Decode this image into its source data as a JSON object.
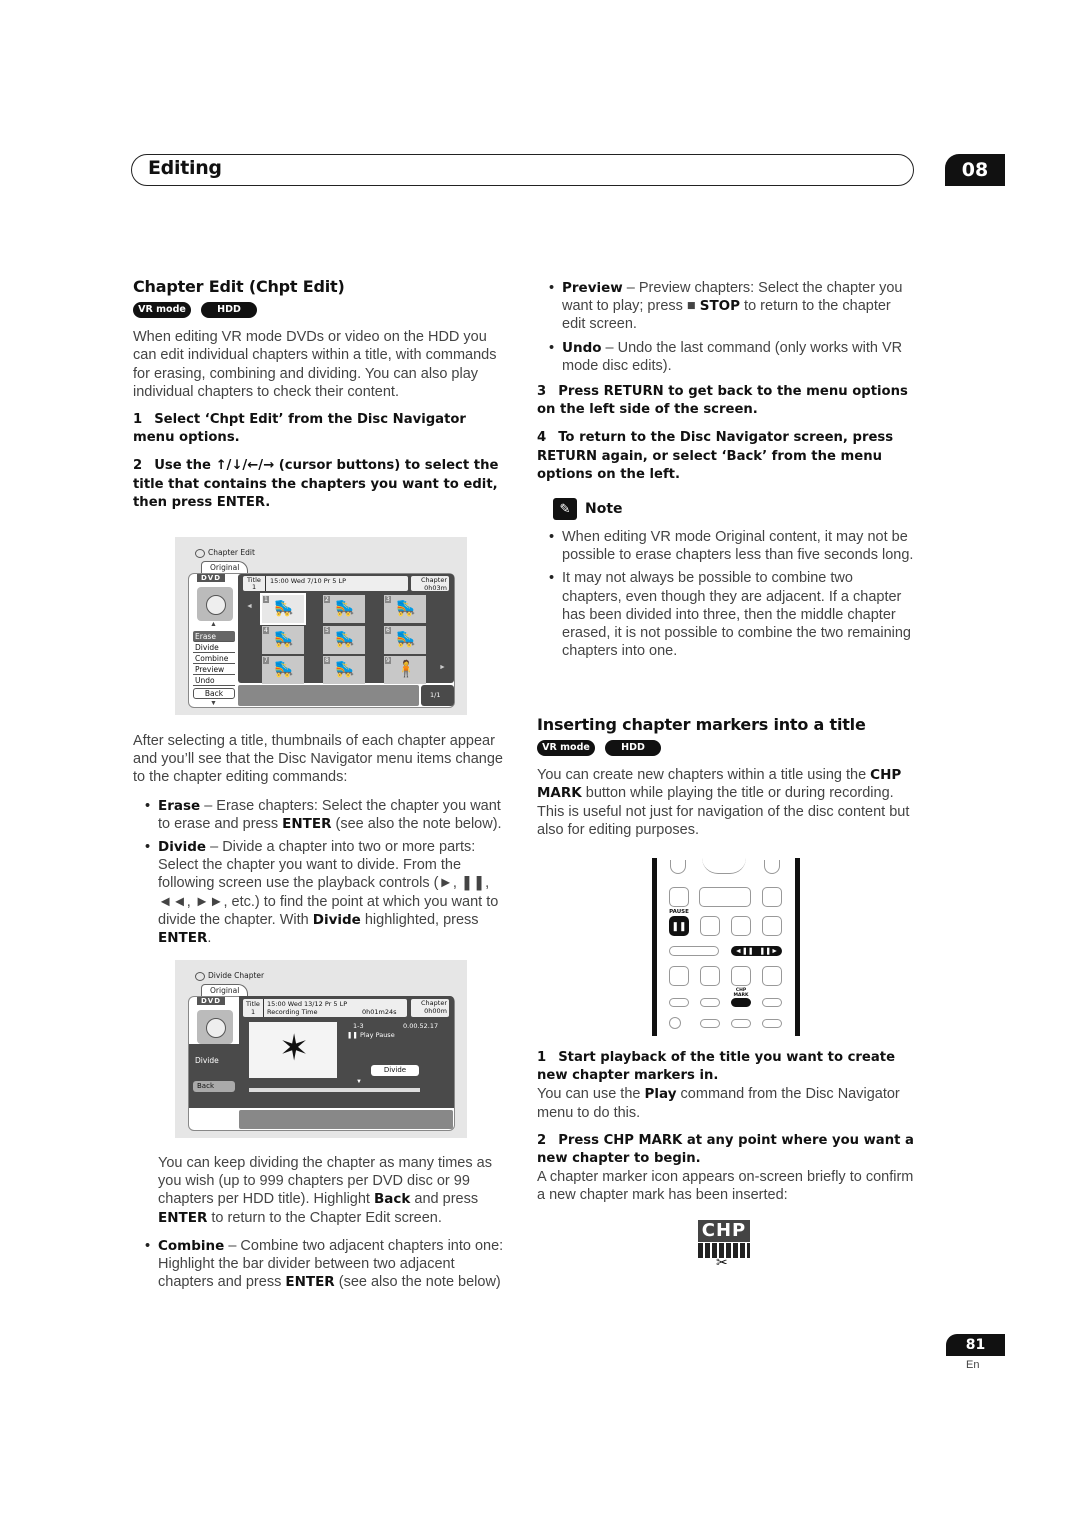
{
  "header": {
    "section_title": "Editing",
    "chapter_number": "08"
  },
  "left": {
    "heading": "Chapter Edit (Chpt Edit)",
    "badges": [
      "VR mode",
      "HDD"
    ],
    "intro": "When editing VR mode DVDs or video on the HDD you can edit individual chapters within a title, with commands for erasing, combining and dividing. You can also play individual chapters to check their content.",
    "step1": {
      "num": "1",
      "text": "Select ‘Chpt Edit’ from the Disc Navigator menu options."
    },
    "step2": {
      "num": "2",
      "text": "Use the ↑/↓/←/→ (cursor buttons) to select the title that contains the chapters you want to edit, then press ENTER."
    },
    "after_text": "After selecting a title, thumbnails of each chapter appear and you’ll see that the Disc Navigator menu items change to the chapter editing commands:",
    "bullets": {
      "erase": {
        "term": "Erase",
        "text": " – Erase chapters: Select the chapter you want to erase and press ",
        "bold2": "ENTER",
        "text2": " (see also the note below)."
      },
      "divide": {
        "term": "Divide",
        "text": " – Divide a chapter into two or more parts: Select the chapter you want to divide. From the following screen use the playback controls (►, ❚❚, ◄◄, ►►, etc.) to find the point at which you want to divide the chapter. With ",
        "bold2": "Divide",
        "text2": " highlighted, press ",
        "bold3": "ENTER",
        "text3": "."
      }
    },
    "divide_followup": {
      "t1": "You can keep dividing the chapter as many times as you wish (up to 999 chapters per DVD disc or 99 chapters per HDD title). Highlight ",
      "b1": "Back",
      "t2": " and press ",
      "b2": "ENTER",
      "t3": " to return to the Chapter Edit screen."
    },
    "combine": {
      "term": "Combine",
      "text": " – Combine two adjacent chapters into one: Highlight the bar divider between two adjacent chapters and press ",
      "bold2": "ENTER",
      "text2": " (see also the note below)"
    }
  },
  "screen1": {
    "title": "Chapter Edit",
    "tab": "Original",
    "disc": "DVD",
    "vr_label": "VR",
    "info_title_label": "Title",
    "info_title_num": "1",
    "info_text": "15:00 Wed  7/10 Pr 5   LP",
    "chapter_label": "Chapter",
    "chapter_time": "0h03m",
    "menu": [
      "Erase",
      "Divide",
      "Combine",
      "Preview",
      "Undo"
    ],
    "selected_menu": "Erase",
    "back": "Back",
    "thumbnails": [
      "1",
      "2",
      "3",
      "4",
      "5",
      "6",
      "7",
      "8",
      "9"
    ],
    "page": "1/1"
  },
  "screen2": {
    "title": "Divide Chapter",
    "tab": "Original",
    "disc": "DVD",
    "vr_label": "VR",
    "info_title_label": "Title",
    "info_title_num": "1",
    "info_line1": "15:00 Wed  13/12   Pr 5     LP",
    "info_line2_label": "Recording Time",
    "info_line2_value": "0h01m24s",
    "chapter_label": "Chapter",
    "chapter_time": "0h00m",
    "position": "1-3",
    "timecode": "0.00.52.17",
    "play_state": "❚❚ Play Pause",
    "menu_divide": "Divide",
    "divide_button": "Divide",
    "back": "Back"
  },
  "right": {
    "bullets": {
      "preview": {
        "term": "Preview",
        "text": " – Preview chapters: Select the chapter you want to play; press ■ ",
        "bold2": "STOP",
        "text2": " to return to the chapter edit screen."
      },
      "undo": {
        "term": "Undo",
        "text": " – Undo the last command (only works with VR mode disc edits)."
      }
    },
    "step3": {
      "num": "3",
      "text": "Press RETURN to get back to the menu options on the left side of the screen."
    },
    "step4": {
      "num": "4",
      "text": "To return to the Disc Navigator screen, press RETURN again, or select ‘Back’ from the menu options on the left."
    },
    "note_label": "Note",
    "notes": [
      "When editing VR mode Original content, it may not be possible to erase chapters less than five seconds long.",
      "It may not always be possible to combine two chapters, even though they are adjacent. If a chapter has been divided into three, then the middle chapter erased, it is not possible to combine the two remaining chapters into one."
    ],
    "heading2": "Inserting chapter markers into a title",
    "badges": [
      "VR mode",
      "HDD"
    ],
    "intro2": {
      "t1": "You can create new chapters within a title using the ",
      "b1": "CHP MARK",
      "t2": " button while playing the title or during recording. This is useful not just for navigation of the disc content but also for editing purposes."
    },
    "remote": {
      "pause_label": "PAUSE",
      "chp_mark_label": "CHP MARK"
    },
    "stepA": {
      "num": "1",
      "text": "Start playback of the title you want to create new chapter markers in."
    },
    "stepA_body": {
      "t1": "You can use the ",
      "b1": "Play",
      "t2": " command from the Disc Navigator menu to do this."
    },
    "stepB": {
      "num": "2",
      "text": "Press CHP MARK at any point where you want a new chapter to begin."
    },
    "stepB_body": "A chapter marker icon appears on-screen briefly to confirm a new chapter mark has been inserted:",
    "chp_icon_text": "CHP"
  },
  "footer": {
    "page": "81",
    "lang": "En"
  }
}
